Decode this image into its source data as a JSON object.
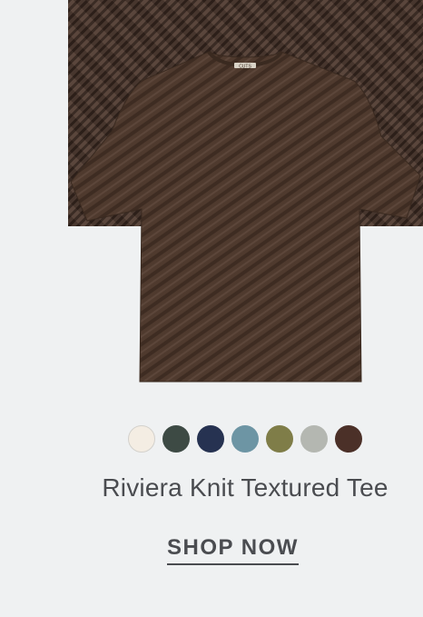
{
  "product": {
    "name": "Riviera Knit Textured Tee",
    "label_brand": "CUTS",
    "swatches": [
      {
        "name": "cream",
        "color": "#f4ede3"
      },
      {
        "name": "dark-green",
        "color": "#3d4a44"
      },
      {
        "name": "navy",
        "color": "#263251"
      },
      {
        "name": "slate-blue",
        "color": "#6d95a4"
      },
      {
        "name": "olive",
        "color": "#7f7d48"
      },
      {
        "name": "light-gray",
        "color": "#b4b7b1"
      },
      {
        "name": "brown",
        "color": "#4b3028"
      }
    ],
    "tee_color": "#4f3a2e"
  },
  "cta": {
    "label": "SHOP NOW"
  }
}
